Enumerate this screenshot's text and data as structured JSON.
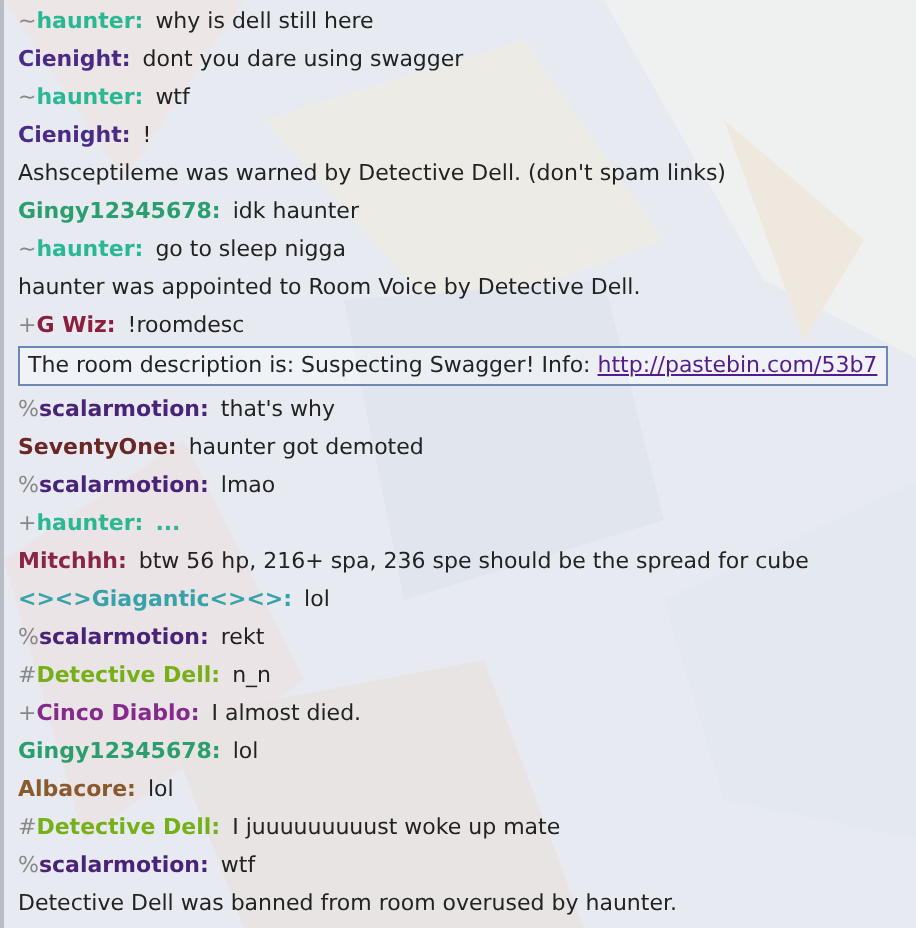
{
  "messages": [
    {
      "kind": "chat",
      "rank": "~",
      "user": "haunter:",
      "color": "#2ab894",
      "text": "why is dell still here"
    },
    {
      "kind": "chat",
      "user": "Cienight:",
      "color": "#4b2a86",
      "text": "dont you dare using swagger"
    },
    {
      "kind": "chat",
      "rank": "~",
      "user": "haunter:",
      "color": "#2ab894",
      "text": "wtf"
    },
    {
      "kind": "chat",
      "user": "Cienight:",
      "color": "#4b2a86",
      "text": "!"
    },
    {
      "kind": "notice",
      "text": "Ashsceptileme was warned by Detective Dell. (don't spam links)"
    },
    {
      "kind": "chat",
      "user": "Gingy12345678:",
      "color": "#2b9e6e",
      "text": "idk haunter"
    },
    {
      "kind": "chat",
      "rank": "~",
      "user": "haunter:",
      "color": "#2ab894",
      "text": "go to sleep nigga"
    },
    {
      "kind": "notice",
      "text": "haunter was appointed to Room Voice by Detective Dell."
    },
    {
      "kind": "chat",
      "rank": "+",
      "user": "G Wiz:",
      "color": "#8c1f3c",
      "text": "!roomdesc"
    },
    {
      "kind": "roomdesc",
      "text": "The room description is: Suspecting Swagger! Info:",
      "link": "http://pastebin.com/53b7"
    },
    {
      "kind": "chat",
      "rank": "%",
      "user": "scalarmotion:",
      "color": "#4a2378",
      "text": "that's why"
    },
    {
      "kind": "chat",
      "user": "SeventyOne:",
      "color": "#6b2626",
      "text": "haunter got demoted"
    },
    {
      "kind": "chat",
      "rank": "%",
      "user": "scalarmotion:",
      "color": "#4a2378",
      "text": "lmao"
    },
    {
      "kind": "chat",
      "rank": "+",
      "user": "haunter:",
      "color": "#2ab894",
      "text": "...",
      "bold": true
    },
    {
      "kind": "chat",
      "user": "Mitchhh:",
      "color": "#8a2448",
      "text": "btw 56 hp, 216+ spa, 236 spe should be the spread for cube"
    },
    {
      "kind": "chat",
      "user": "<><>Giagantic<><>:",
      "color": "#36a3aa",
      "text": "lol"
    },
    {
      "kind": "chat",
      "rank": "%",
      "user": "scalarmotion:",
      "color": "#4a2378",
      "text": "rekt"
    },
    {
      "kind": "chat",
      "rank": "#",
      "user": "Detective Dell:",
      "color": "#76b019",
      "text": "n_n"
    },
    {
      "kind": "chat",
      "rank": "+",
      "user": "Cinco Diablo:",
      "color": "#852a8c",
      "text": "I almost died."
    },
    {
      "kind": "chat",
      "user": "Gingy12345678:",
      "color": "#2b9e6e",
      "text": "lol"
    },
    {
      "kind": "chat",
      "user": "Albacore:",
      "color": "#8a5a2c",
      "text": "lol"
    },
    {
      "kind": "chat",
      "rank": "#",
      "user": "Detective Dell:",
      "color": "#76b019",
      "text": "I juuuuuuuuust woke up mate"
    },
    {
      "kind": "chat",
      "rank": "%",
      "user": "scalarmotion:",
      "color": "#4a2378",
      "text": "wtf"
    },
    {
      "kind": "notice",
      "text": "Detective Dell was banned from room overused by haunter."
    }
  ]
}
